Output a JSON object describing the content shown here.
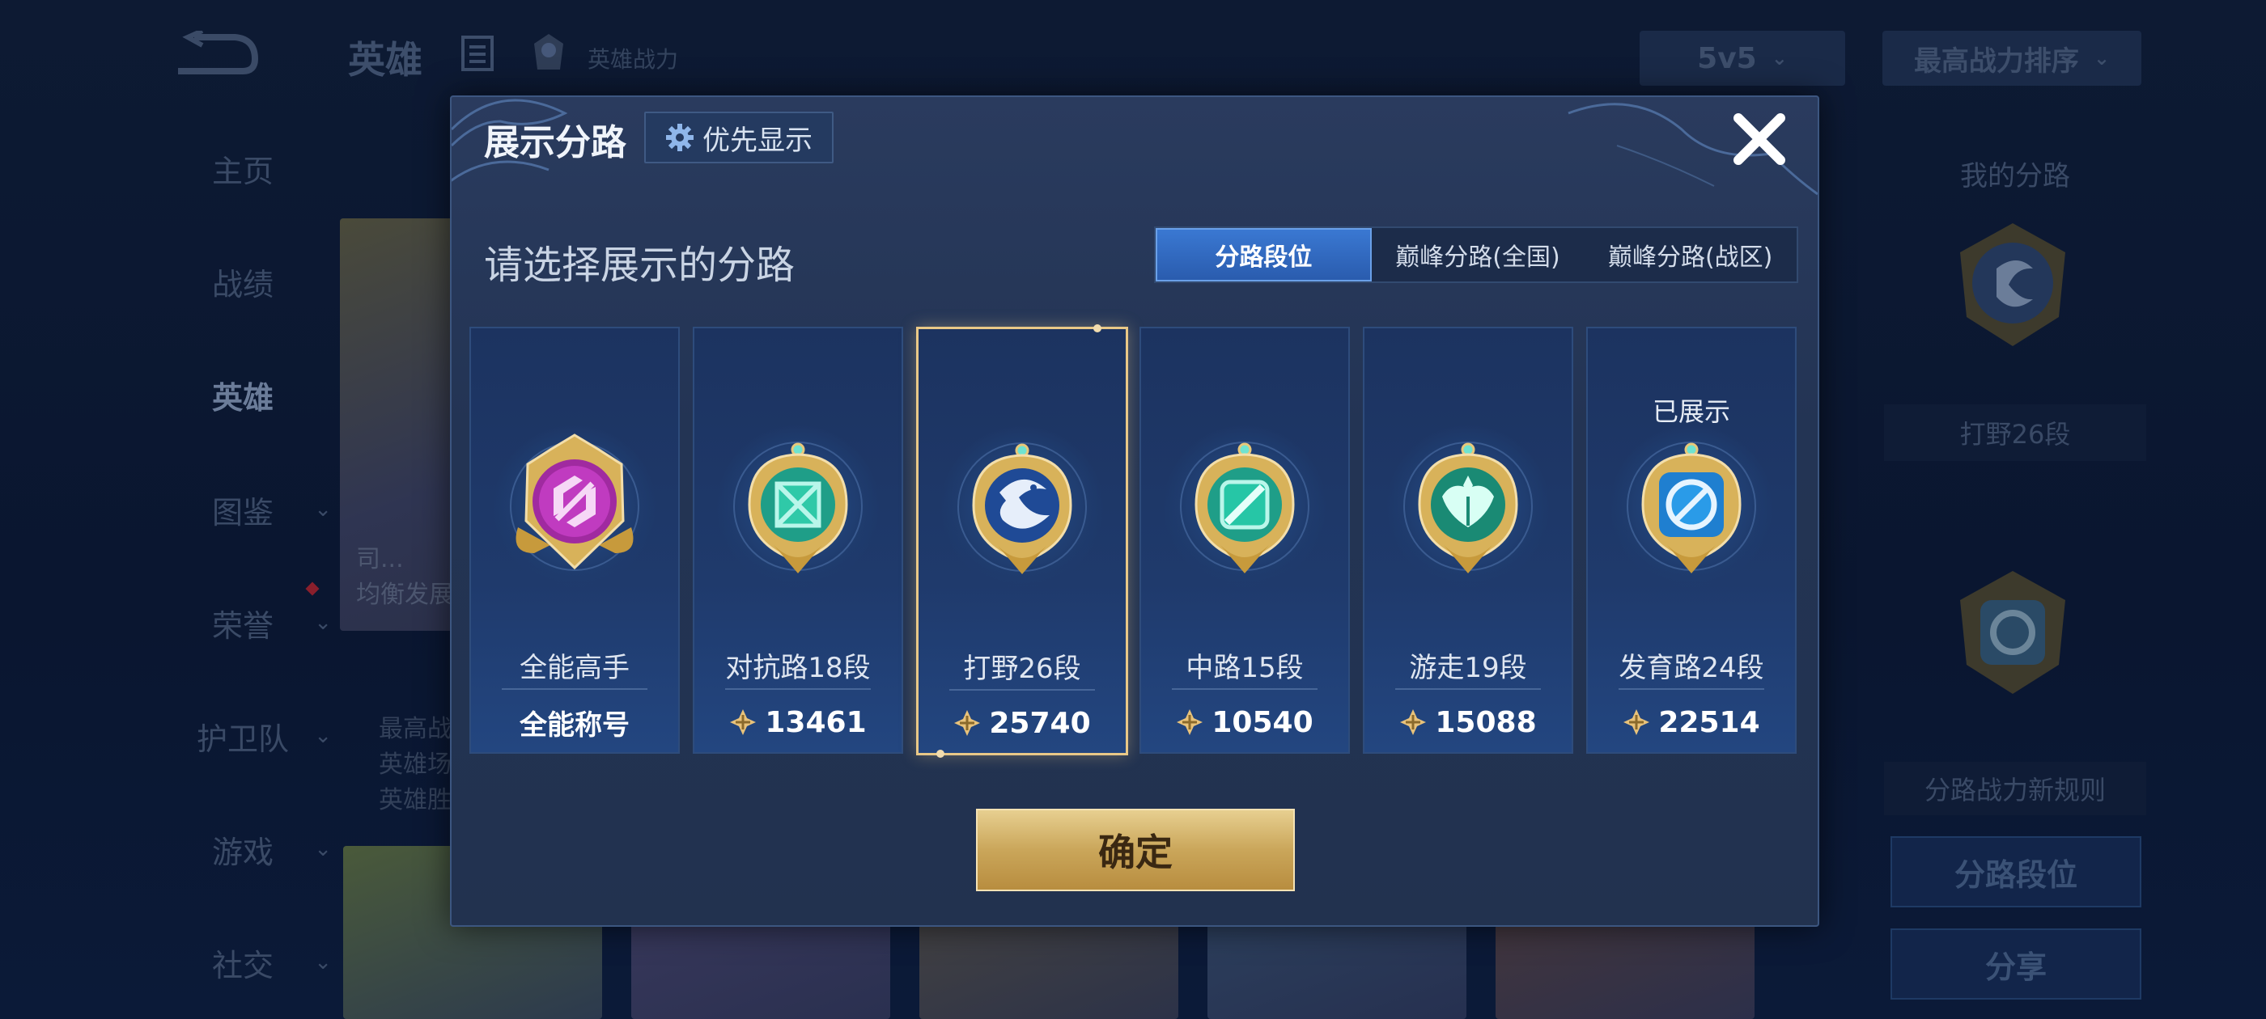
{
  "background": {
    "header": {
      "title": "英雄",
      "power_label": "英雄战力"
    },
    "mode_select": {
      "value": "5v5"
    },
    "sort_select": {
      "value": "最高战力排序"
    },
    "nav": [
      {
        "label": "主页"
      },
      {
        "label": "战绩"
      },
      {
        "label": "英雄"
      },
      {
        "label": "图鉴"
      },
      {
        "label": "荣誉"
      },
      {
        "label": "护卫队"
      },
      {
        "label": "游戏"
      },
      {
        "label": "社交"
      }
    ],
    "hero_card": {
      "line1": "司...",
      "line2": "均衡发展"
    },
    "hero_stats": [
      "最高战...",
      "英雄场...",
      "英雄胜..."
    ],
    "right": {
      "my_lane_title": "我的分路",
      "lane_label": "打野26段",
      "rule_label": "分路战力新规则",
      "lane_rank_button": "分路段位",
      "share_button": "分享"
    }
  },
  "modal": {
    "title": "展示分路",
    "priority_button": "优先显示",
    "subtitle": "请选择展示的分路",
    "tabs": [
      {
        "label": "分路段位",
        "active": true
      },
      {
        "label": "巅峰分路(全国)",
        "active": false
      },
      {
        "label": "巅峰分路(战区)",
        "active": false
      }
    ],
    "cards": [
      {
        "name": "全能高手",
        "value": "全能称号",
        "is_title": true,
        "icon": "all-round-badge-icon",
        "color": "#c03bc0"
      },
      {
        "name": "对抗路18段",
        "value": "13461",
        "icon": "clash-lane-badge-icon",
        "color": "#2fc9a8"
      },
      {
        "name": "打野26段",
        "value": "25740",
        "icon": "jungle-badge-icon",
        "color": "#2a5db8",
        "selected": true
      },
      {
        "name": "中路15段",
        "value": "10540",
        "icon": "mid-lane-badge-icon",
        "color": "#26c6a6"
      },
      {
        "name": "游走19段",
        "value": "15088",
        "icon": "roam-badge-icon",
        "color": "#1fa887"
      },
      {
        "name": "发育路24段",
        "value": "22514",
        "icon": "farm-lane-badge-icon",
        "color": "#2a9be8",
        "shown_label": "已展示"
      }
    ],
    "confirm_button": "确定"
  }
}
